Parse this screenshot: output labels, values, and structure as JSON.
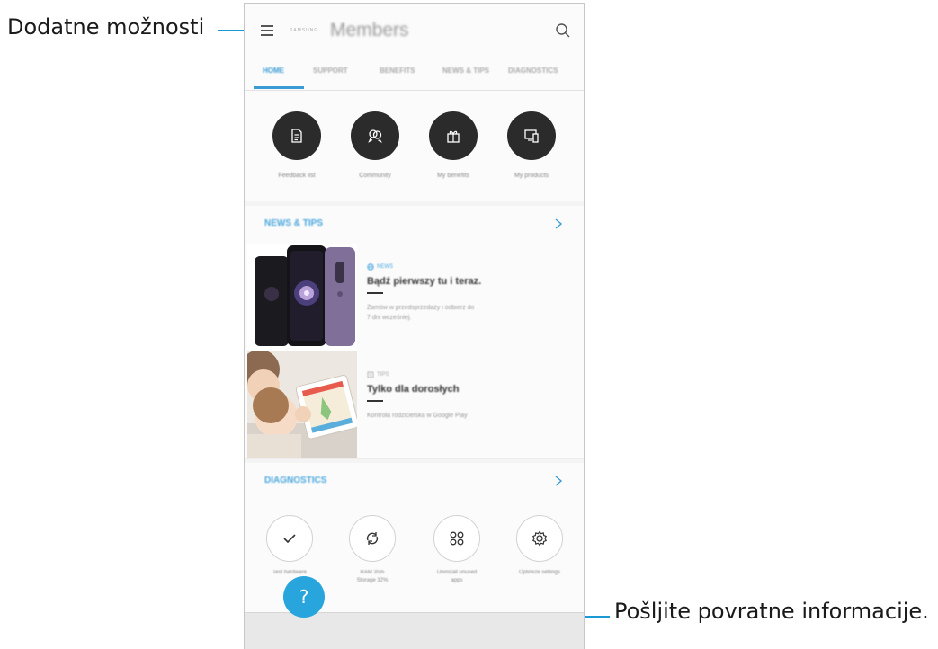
{
  "annotations": {
    "more_options": "Dodatne možnosti",
    "send_feedback": "Pošljite povratne informacije."
  },
  "header": {
    "brand": "SAMSUNG",
    "title": "Members"
  },
  "tabs": [
    {
      "label": "HOME",
      "active": true
    },
    {
      "label": "SUPPORT"
    },
    {
      "label": "BENEFITS"
    },
    {
      "label": "NEWS & TIPS"
    },
    {
      "label": "DIAGNOSTICS"
    }
  ],
  "quick_actions": [
    {
      "label": "Feedback list",
      "icon": "document-icon"
    },
    {
      "label": "Community",
      "icon": "community-icon"
    },
    {
      "label": "My benefits",
      "icon": "gift-icon"
    },
    {
      "label": "My products",
      "icon": "devices-icon"
    }
  ],
  "news": {
    "title": "NEWS & TIPS",
    "articles": [
      {
        "category": "NEWS",
        "title": "Bądź pierwszy tu i teraz.",
        "subtitle_line1": "Zamów w przedsprzedaży i odbierz do",
        "subtitle_line2": "7 dni wcześniej.",
        "thumb": "galaxy-phones-image"
      },
      {
        "category": "TIPS",
        "title": "Tylko dla dorosłych",
        "subtitle_line1": "Kontrola rodzicielska w Google Play",
        "thumb": "child-tablet-image"
      }
    ]
  },
  "diagnostics": {
    "title": "DIAGNOSTICS",
    "items": [
      {
        "label_line1": "Test hardware",
        "label_line2": "",
        "icon": "check-icon"
      },
      {
        "label_line1": "RAM 35%",
        "label_line2": "Storage 32%",
        "icon": "refresh-icon"
      },
      {
        "label_line1": "Uninstall unused",
        "label_line2": "apps",
        "icon": "apps-icon"
      },
      {
        "label_line1": "Optimize settings",
        "label_line2": "",
        "icon": "settings-gear-icon"
      }
    ]
  },
  "fab": {
    "label": "?"
  },
  "colors": {
    "accent": "#27a5dc",
    "annotation_line": "#1b9ad6",
    "tab_active": "#3a9bd5"
  }
}
